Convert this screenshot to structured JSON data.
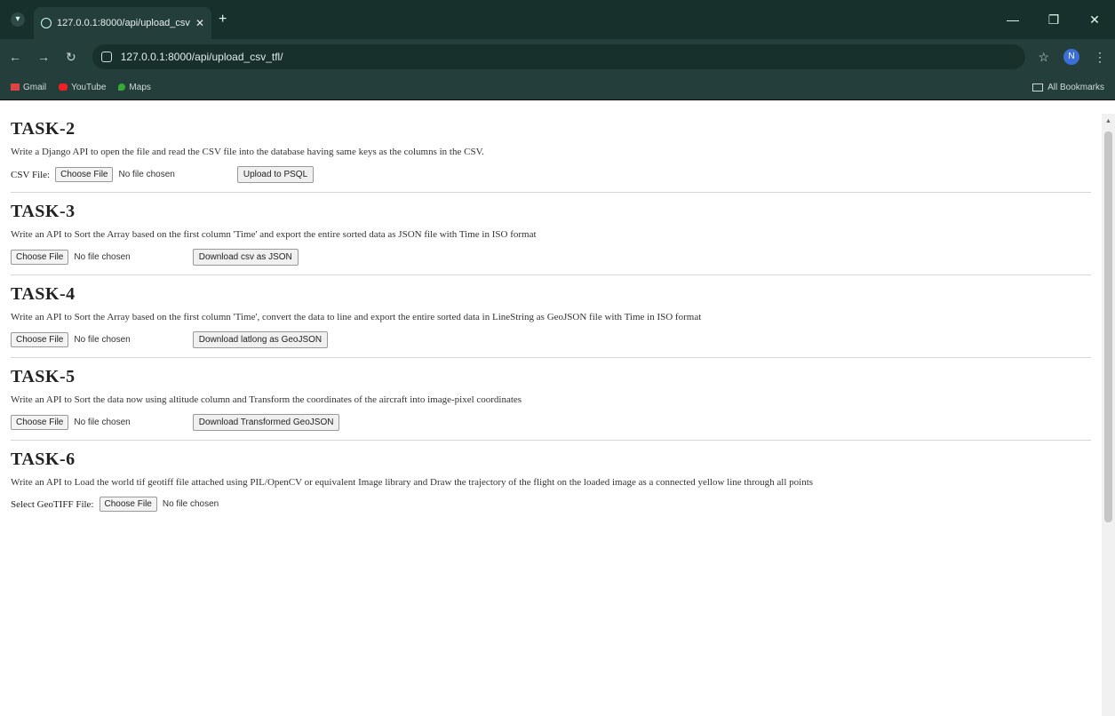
{
  "browser": {
    "tab_title": "127.0.0.1:8000/api/upload_csv",
    "url": "127.0.0.1:8000/api/upload_csv_tfl/",
    "bookmarks": [
      "Gmail",
      "YouTube",
      "Maps"
    ],
    "all_bookmarks": "All Bookmarks",
    "avatar_letter": "N"
  },
  "tasks": [
    {
      "title": "TASK-2",
      "description": "Write a Django API to open the file and read the CSV file into the database having same keys as the columns in the CSV.",
      "input_label": "CSV File:",
      "choose_label": "Choose File",
      "no_file": "No file chosen",
      "action_label": "Upload to PSQL"
    },
    {
      "title": "TASK-3",
      "description": "Write an API to Sort the Array based on the first column 'Time' and export the entire sorted data as JSON file with Time in ISO format",
      "choose_label": "Choose File",
      "no_file": "No file chosen",
      "action_label": "Download csv as JSON"
    },
    {
      "title": "TASK-4",
      "description": "Write an API to Sort the Array based on the first column 'Time', convert the data to line and export the entire sorted data in LineString as GeoJSON file with Time in ISO format",
      "choose_label": "Choose File",
      "no_file": "No file chosen",
      "action_label": "Download latlong as GeoJSON"
    },
    {
      "title": "TASK-5",
      "description": "Write an API to Sort the data now using altitude column and Transform the coordinates of the aircraft into image-pixel coordinates",
      "choose_label": "Choose File",
      "no_file": "No file chosen",
      "action_label": "Download Transformed GeoJSON"
    },
    {
      "title": "TASK-6",
      "description": "Write an API to Load the world tif geotiff file attached using PIL/OpenCV or equivalent Image library and Draw the trajectory of the flight on the loaded image as a connected yellow line through all points",
      "input_label": "Select GeoTIFF File:",
      "choose_label": "Choose File",
      "no_file": "No file chosen"
    }
  ]
}
